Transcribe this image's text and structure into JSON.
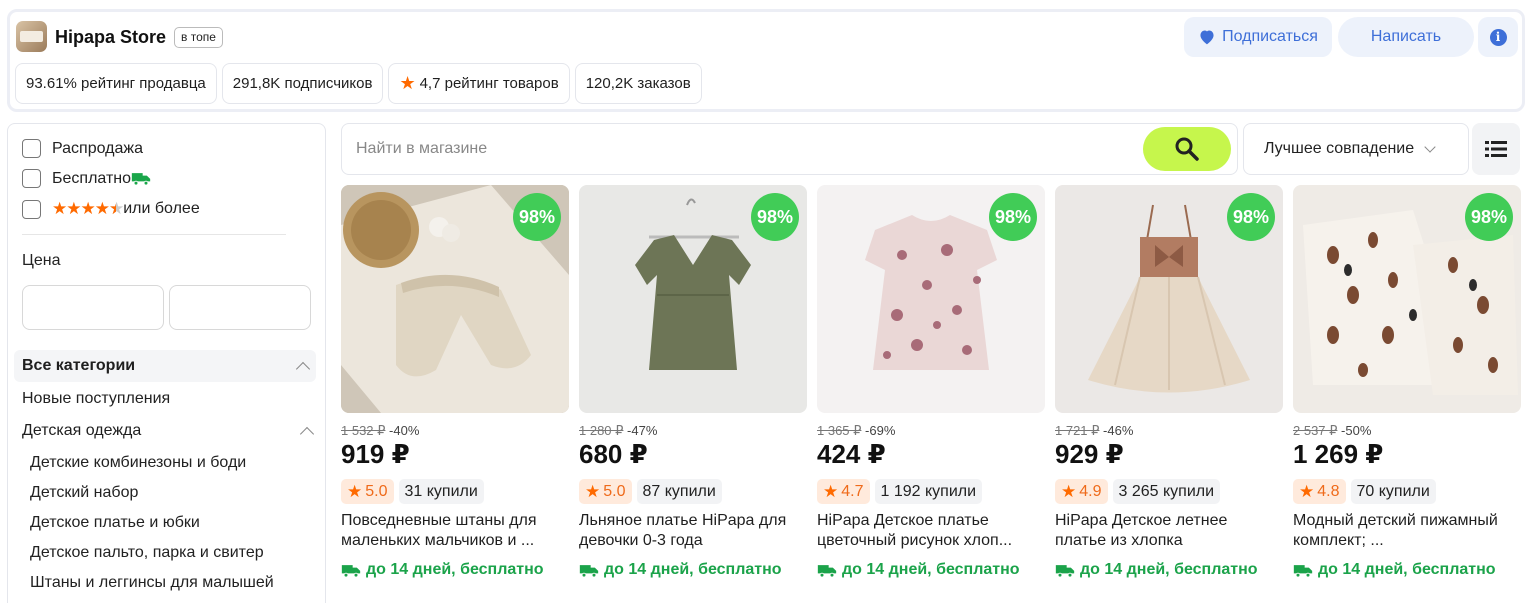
{
  "store": {
    "name": "Hipapa Store",
    "badge": "в топе",
    "subscribe_label": "Подписаться",
    "write_label": "Написать",
    "info_glyph": "i",
    "stats": [
      {
        "text": "93.61% рейтинг продавца",
        "icon": ""
      },
      {
        "text": "291,8K подписчиков",
        "icon": ""
      },
      {
        "text": "4,7 рейтинг товаров",
        "icon": "star-icon"
      },
      {
        "text": "120,2K заказов",
        "icon": ""
      }
    ]
  },
  "filters": {
    "sale_label": "Распродажа",
    "free_label": "Бесплатно",
    "rating_suffix": "или более",
    "rating_value": 4.5,
    "price_label": "Цена"
  },
  "categories": {
    "all_label": "Все категории",
    "new_label": "Новые поступления",
    "kids_label": "Детская одежда",
    "sub_items": [
      "Детские комбинезоны и боди",
      "Детский набор",
      "Детское платье и юбки",
      "Детское пальто, парка и свитер",
      "Штаны и леггинсы для малышей"
    ]
  },
  "search": {
    "placeholder": "Найти в магазине",
    "sort_label": "Лучшее совпадение"
  },
  "products": [
    {
      "badge": "98%",
      "old_price": "1 532 ₽",
      "discount": "-40%",
      "price": "919 ₽",
      "rating": "5.0",
      "bought": "31 купили",
      "title": "Повседневные штаны для маленьких мальчиков и ...",
      "delivery": "до 14 дней, бесплатно"
    },
    {
      "badge": "98%",
      "old_price": "1 280 ₽",
      "discount": "-47%",
      "price": "680 ₽",
      "rating": "5.0",
      "bought": "87 купили",
      "title": "Льняное платье HiPapa для девочки 0-3 года",
      "delivery": "до 14 дней, бесплатно"
    },
    {
      "badge": "98%",
      "old_price": "1 365 ₽",
      "discount": "-69%",
      "price": "424 ₽",
      "rating": "4.7",
      "bought": "1 192 купили",
      "title": "HiPapa Детское платье цветочный рисунок хлоп...",
      "delivery": "до 14 дней, бесплатно"
    },
    {
      "badge": "98%",
      "old_price": "1 721 ₽",
      "discount": "-46%",
      "price": "929 ₽",
      "rating": "4.9",
      "bought": "3 265 купили",
      "title": "HiPapa Детское летнее платье из хлопка",
      "delivery": "до 14 дней, бесплатно"
    },
    {
      "badge": "98%",
      "old_price": "2 537 ₽",
      "discount": "-50%",
      "price": "1 269 ₽",
      "rating": "4.8",
      "bought": "70 купили",
      "title": "Модный детский пижамный комплект; ...",
      "delivery": "до 14 дней, бесплатно"
    }
  ],
  "colors": {
    "accent_blue": "#3e6fd8",
    "search_button": "#c6f64c",
    "badge_green": "#41cc57",
    "delivery_green": "#1ba34a",
    "rating_orange": "#ff6a00"
  }
}
